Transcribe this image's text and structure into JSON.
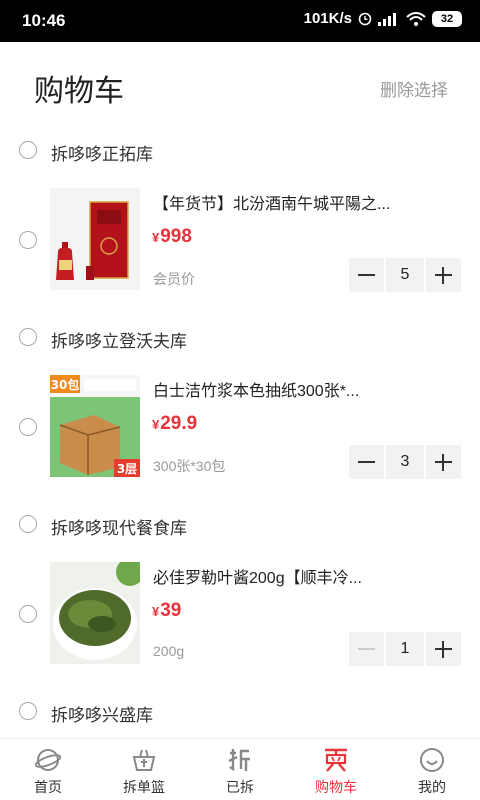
{
  "status_bar": {
    "time": "10:46",
    "speed": "101K/s",
    "battery": "32"
  },
  "header": {
    "title": "购物车",
    "delete_selected": "删除选择"
  },
  "groups": [
    {
      "store": "拆哆哆正拓库",
      "item": {
        "title": "【年货节】北汾酒南午城平陽之...",
        "currency": "¥",
        "price": "998",
        "spec": "会员价",
        "qty": "5"
      }
    },
    {
      "store": "拆哆哆立登沃夫库",
      "item": {
        "title": "白士洁竹浆本色抽纸300张*...",
        "currency": "¥",
        "price": "29.9",
        "spec": "300张*30包",
        "qty": "3",
        "image_text": {
          "top_left": "30包",
          "bottom_right": "3层"
        }
      }
    },
    {
      "store": "拆哆哆现代餐食库",
      "item": {
        "title": "必佳罗勒叶酱200g【顺丰冷...",
        "currency": "¥",
        "price": "39",
        "spec": "200g",
        "qty": "1"
      }
    },
    {
      "store": "拆哆哆兴盛库"
    }
  ],
  "tabbar": [
    {
      "label": "首页",
      "icon": "planet-icon"
    },
    {
      "label": "拆单篮",
      "icon": "basket-icon"
    },
    {
      "label": "已拆",
      "icon": "chai-icon"
    },
    {
      "label": "购物车",
      "icon": "cart-icon",
      "active": true
    },
    {
      "label": "我的",
      "icon": "smile-icon"
    }
  ],
  "colors": {
    "accent": "#e8333a",
    "muted": "#999999",
    "stepper_bg": "#f2f2f2"
  }
}
